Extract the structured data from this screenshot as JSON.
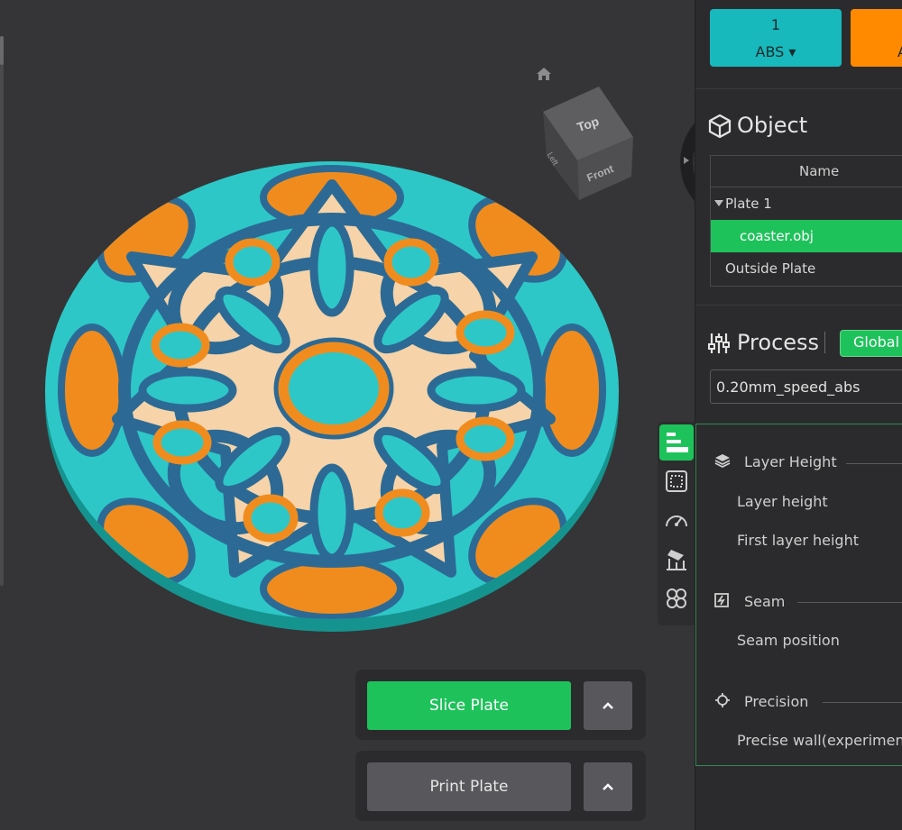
{
  "viewport": {
    "view_cube": {
      "top_label": "Top",
      "front_label": "Front",
      "left_label": "Left"
    },
    "icons": {
      "home": "home-icon"
    }
  },
  "actions": {
    "slice_label": "Slice Plate",
    "print_label": "Print Plate"
  },
  "filaments": [
    {
      "number": "1",
      "material": "ABS ▾",
      "color": "#17b9bd"
    },
    {
      "number": "",
      "material": "A",
      "color": "#ff8a00"
    }
  ],
  "object_panel": {
    "title": "Object",
    "column_name": "Name",
    "rows": [
      {
        "label": "Plate 1"
      },
      {
        "label": "coaster.obj"
      },
      {
        "label": "Outside Plate"
      }
    ]
  },
  "process_panel": {
    "title": "Process",
    "scope_button": "Global",
    "preset": "0.20mm_speed_abs"
  },
  "params": {
    "layer_height": {
      "title": "Layer Height",
      "items": [
        "Layer height",
        "First layer height"
      ]
    },
    "seam": {
      "title": "Seam",
      "items": [
        "Seam position"
      ]
    },
    "precision": {
      "title": "Precision",
      "items": [
        "Precise wall(experiment"
      ]
    }
  },
  "colors": {
    "accent_green": "#1ec25a",
    "teal": "#17b9bd",
    "orange": "#ff8a00",
    "panel_bg": "#2b2b2d",
    "viewport_bg": "#353537"
  }
}
